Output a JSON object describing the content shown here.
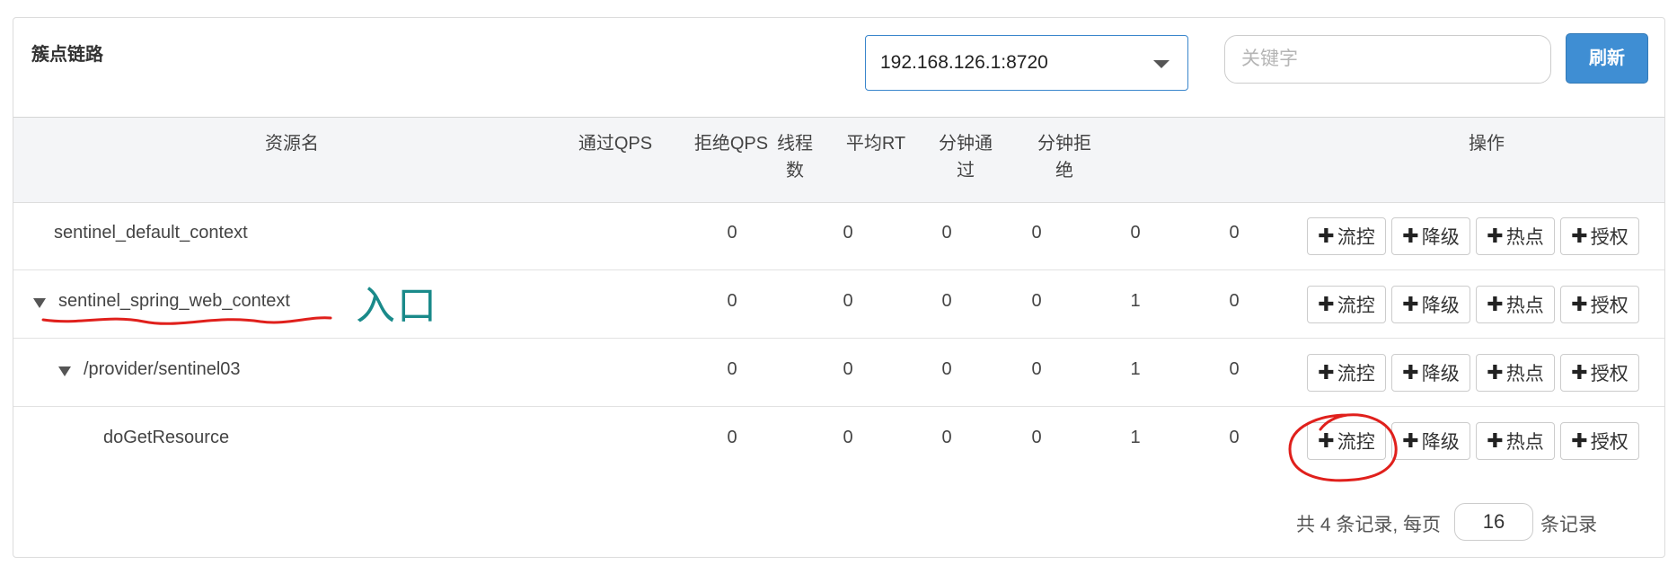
{
  "header": {
    "title": "簇点链路",
    "machine_select": {
      "value": "192.168.126.1:8720"
    },
    "search": {
      "placeholder": "关键字",
      "value": ""
    },
    "refresh_label": "刷新"
  },
  "table": {
    "columns": {
      "resource": "资源名",
      "pass_qps": "通过QPS",
      "block_qps": "拒绝QPS",
      "threads": [
        "线程",
        "数"
      ],
      "avg_rt": "平均RT",
      "minute_pass": [
        "分钟通",
        "过"
      ],
      "minute_block": [
        "分钟拒",
        "绝"
      ],
      "actions": "操作"
    },
    "rows": [
      {
        "name": "sentinel_default_context",
        "pass_qps": "0",
        "block_qps": "0",
        "threads": "0",
        "avg_rt": "0",
        "minute_pass": "0",
        "minute_block": "0"
      },
      {
        "name": "sentinel_spring_web_context",
        "pass_qps": "0",
        "block_qps": "0",
        "threads": "0",
        "avg_rt": "0",
        "minute_pass": "1",
        "minute_block": "0"
      },
      {
        "name": "/provider/sentinel03",
        "pass_qps": "0",
        "block_qps": "0",
        "threads": "0",
        "avg_rt": "0",
        "minute_pass": "1",
        "minute_block": "0"
      },
      {
        "name": "doGetResource",
        "pass_qps": "0",
        "block_qps": "0",
        "threads": "0",
        "avg_rt": "0",
        "minute_pass": "1",
        "minute_block": "0"
      }
    ],
    "action_labels": {
      "plus": "✚",
      "flow": "流控",
      "degrade": "降级",
      "hotspot": "热点",
      "auth": "授权"
    }
  },
  "pagination": {
    "summary": "共 4 条记录, 每页",
    "page_size": "16",
    "suffix": "条记录"
  },
  "annotation": {
    "text": "入口",
    "color": "#e0201c"
  }
}
